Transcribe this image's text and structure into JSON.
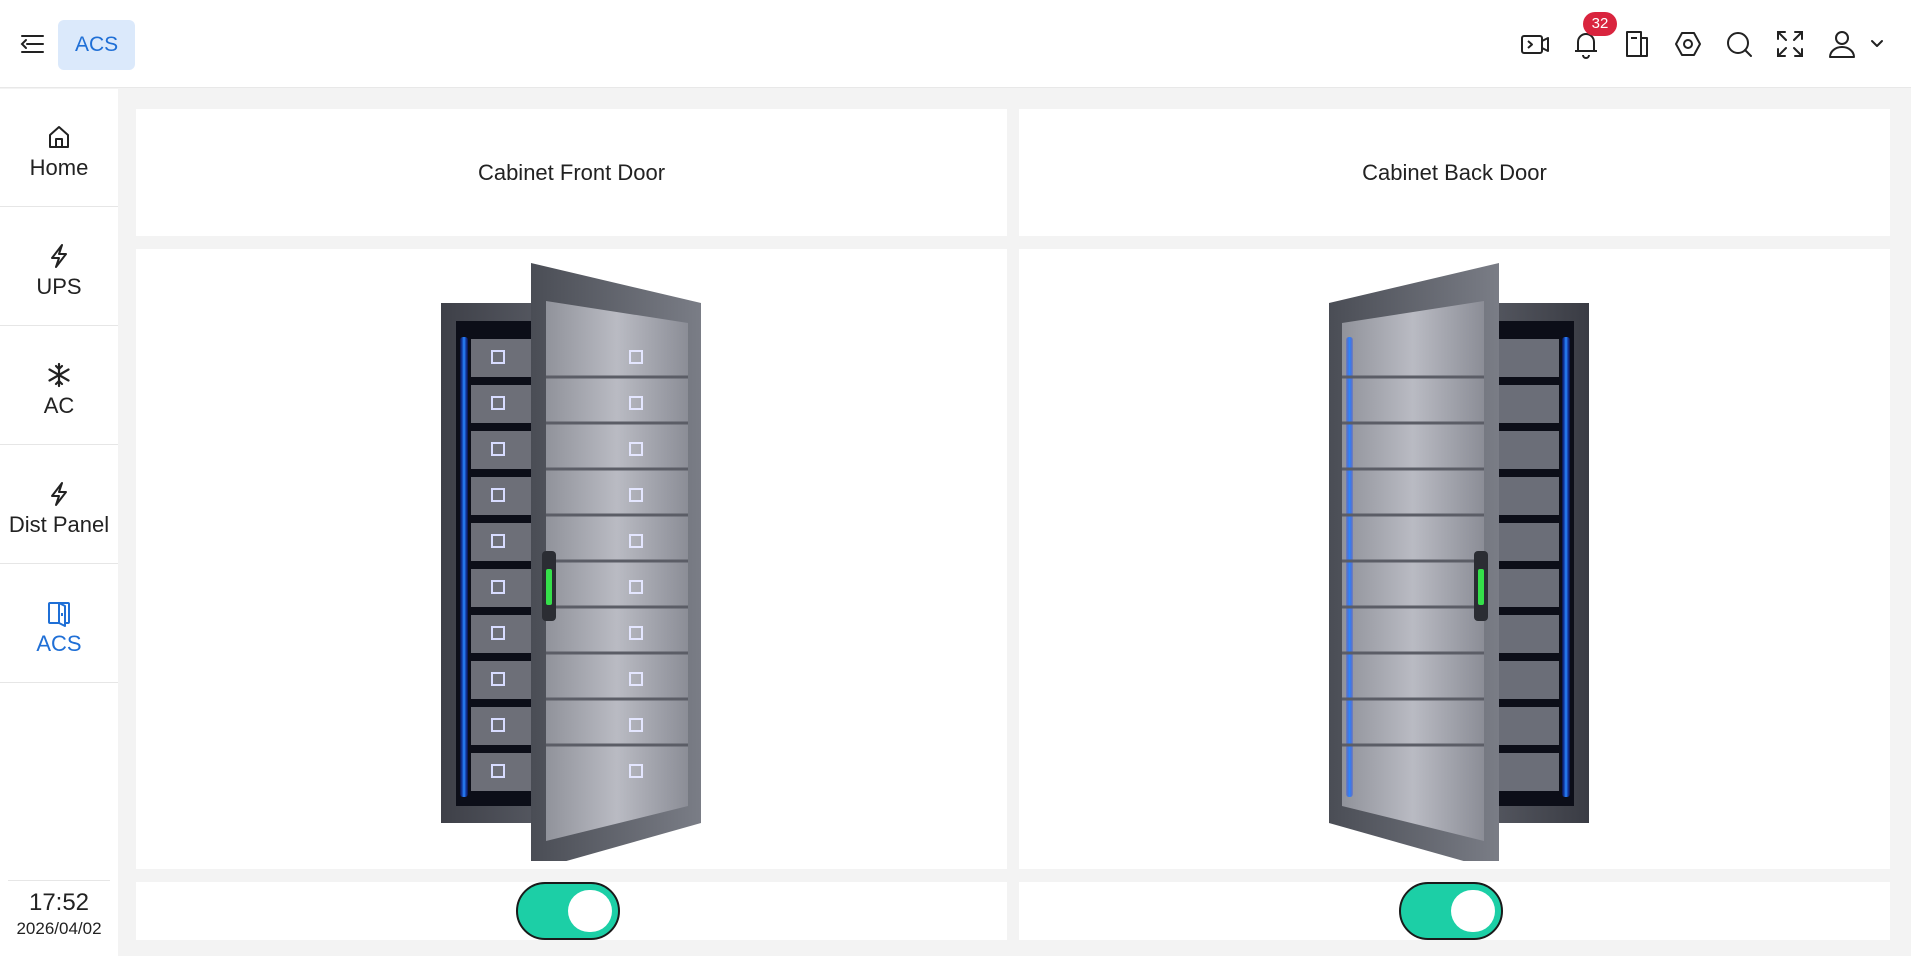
{
  "header": {
    "breadcrumb_tag": "ACS",
    "notification_count": "32",
    "tools": [
      "video-terminal-icon",
      "bell-icon",
      "document-icon",
      "settings-hex-icon",
      "search-icon",
      "fullscreen-icon"
    ],
    "user_icon": "user-icon"
  },
  "sidebar": {
    "items": [
      {
        "label": "Home",
        "icon": "home-icon"
      },
      {
        "label": "UPS",
        "icon": "bolt-icon"
      },
      {
        "label": "AC",
        "icon": "snowflake-icon"
      },
      {
        "label": "Dist Panel",
        "icon": "bolt-icon"
      },
      {
        "label": "ACS",
        "icon": "door-icon",
        "active": true
      }
    ],
    "time": "17:52",
    "date": "2026/04/02"
  },
  "doors": [
    {
      "title": "Cabinet Front Door",
      "state": "open",
      "toggle_on": true
    },
    {
      "title": "Cabinet Back Door",
      "state": "open",
      "toggle_on": true
    }
  ],
  "colors": {
    "accent": "#1f6fd6",
    "toggle_on": "#1ccfa6",
    "badge": "#d9243e",
    "led_blue": "#1a5cff"
  }
}
